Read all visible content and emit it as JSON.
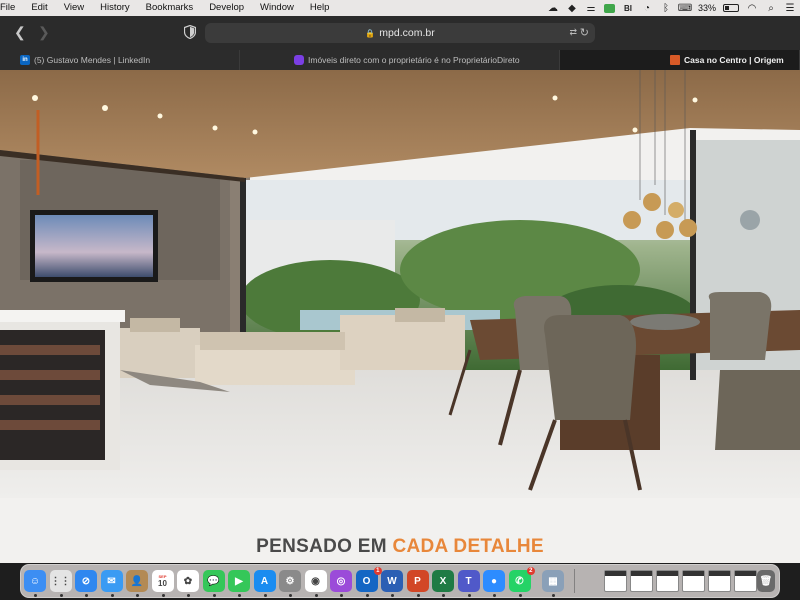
{
  "menubar": {
    "items": [
      "File",
      "Edit",
      "View",
      "History",
      "Bookmarks",
      "Develop",
      "Window",
      "Help"
    ],
    "battery_percent": "33%",
    "battery_level": 0.33
  },
  "toolbar": {
    "url": "mpd.com.br"
  },
  "tabs": [
    {
      "label": "(5) Gustavo Mendes | LinkedIn",
      "icon": "linkedin-icon"
    },
    {
      "label": "Imóveis direto com o proprietário é no ProprietárioDireto",
      "icon": "proprietariodireto-icon"
    },
    {
      "label": "Casa no Centro | Origem",
      "icon": "house-icon",
      "active": true
    }
  ],
  "page": {
    "heading_plain": "PENSADO EM ",
    "heading_accent": "CADA DETALHE",
    "accent_color": "#e8873a"
  },
  "dock": {
    "apps": [
      {
        "name": "finder",
        "color": "#3c8ef3",
        "glyph": "☺"
      },
      {
        "name": "launchpad",
        "color": "#e4e4e4",
        "glyph": "⋮⋮"
      },
      {
        "name": "safari",
        "color": "#2f87f0",
        "glyph": "⊘"
      },
      {
        "name": "mail",
        "color": "#3a9bf3",
        "glyph": "✉"
      },
      {
        "name": "contacts",
        "color": "#b38a54",
        "glyph": "👤"
      },
      {
        "name": "calendar",
        "color": "#ffffff",
        "glyph": "10"
      },
      {
        "name": "photos",
        "color": "#ffffff",
        "glyph": "✿"
      },
      {
        "name": "messages",
        "color": "#35c759",
        "glyph": "💬"
      },
      {
        "name": "facetime",
        "color": "#35c759",
        "glyph": "▶"
      },
      {
        "name": "app-store",
        "color": "#1a8cf0",
        "glyph": "A"
      },
      {
        "name": "system-preferences",
        "color": "#8a8a8a",
        "glyph": "⚙"
      },
      {
        "name": "chrome",
        "color": "#ffffff",
        "glyph": "◉"
      },
      {
        "name": "podcasts",
        "color": "#9b4bd9",
        "glyph": "◎"
      },
      {
        "name": "outlook",
        "color": "#1466c4",
        "glyph": "O",
        "badge": "1"
      },
      {
        "name": "word",
        "color": "#2b5fb4",
        "glyph": "W"
      },
      {
        "name": "powerpoint",
        "color": "#d24726",
        "glyph": "P"
      },
      {
        "name": "excel",
        "color": "#1f7b44",
        "glyph": "X"
      },
      {
        "name": "teams",
        "color": "#5059c9",
        "glyph": "T"
      },
      {
        "name": "zoom",
        "color": "#2d8cff",
        "glyph": "●"
      },
      {
        "name": "whatsapp",
        "color": "#25d366",
        "glyph": "✆",
        "badge": "2"
      },
      {
        "name": "preview",
        "color": "#8aa0b8",
        "glyph": "▦"
      }
    ],
    "calendar_month": "SEP",
    "calendar_day": "10"
  }
}
